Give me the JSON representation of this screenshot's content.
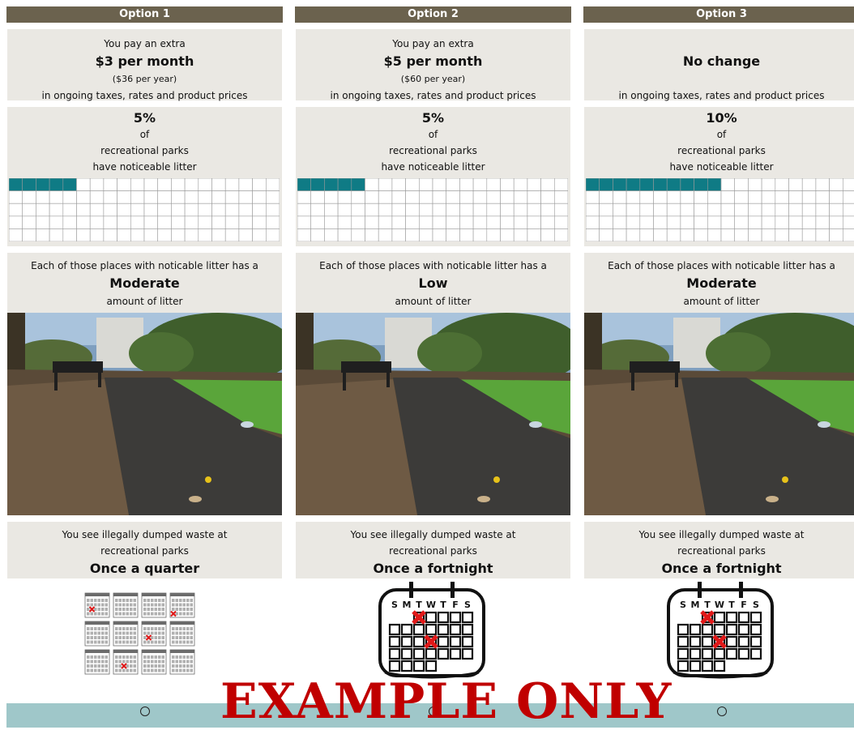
{
  "options": [
    {
      "header": "Option 1",
      "cost_line1": "You pay an extra",
      "cost_main": "$3 per month",
      "cost_sub": "($36 per year)",
      "cost_line3": "in ongoing taxes, rates and product prices",
      "pct": "5%",
      "pct_of": "of",
      "pct_place": "recreational parks",
      "pct_desc": "have noticeable litter",
      "pct_value": 5,
      "litter_intro": "Each of those places with noticable litter has a",
      "litter_level": "Moderate",
      "litter_outro": "amount of litter",
      "dump_line1": "You see illegally dumped waste at",
      "dump_line2": "recreational parks",
      "dump_freq": "Once a quarter",
      "calendar_icon": "twelve-month-calendars-icon",
      "radio_selected": false
    },
    {
      "header": "Option 2",
      "cost_line1": "You pay an extra",
      "cost_main": "$5 per month",
      "cost_sub": "($60 per year)",
      "cost_line3": "in ongoing taxes, rates and product prices",
      "pct": "5%",
      "pct_of": "of",
      "pct_place": "recreational parks",
      "pct_desc": "have noticeable litter",
      "pct_value": 5,
      "litter_intro": "Each of those places with noticable litter has a",
      "litter_level": "Low",
      "litter_outro": "amount of litter",
      "dump_line1": "You see illegally dumped waste at",
      "dump_line2": "recreational parks",
      "dump_freq": "Once a fortnight",
      "calendar_icon": "monthly-calendar-icon",
      "calendar_days": "S M T W T F S",
      "radio_selected": false
    },
    {
      "header": "Option 3",
      "cost_line1": "",
      "cost_main": "No change",
      "cost_sub": "",
      "cost_line3": "in ongoing taxes, rates and product prices",
      "pct": "10%",
      "pct_of": "of",
      "pct_place": "recreational parks",
      "pct_desc": "have noticeable litter",
      "pct_value": 10,
      "litter_intro": "Each of those places with noticable litter has a",
      "litter_level": "Moderate",
      "litter_outro": "amount of litter",
      "dump_line1": "You see illegally dumped waste at",
      "dump_line2": "recreational parks",
      "dump_freq": "Once a fortnight",
      "calendar_icon": "monthly-calendar-icon",
      "calendar_days": "S M T W T F S",
      "radio_selected": false
    }
  ],
  "watermark": "EXAMPLE ONLY",
  "colors": {
    "header_bg": "#6b624e",
    "panel_bg": "#eae8e3",
    "grid_fill": "#0f7b85",
    "mark_red": "#e01818",
    "bottom_bar": "#9fc7c9",
    "watermark": "#c00000"
  }
}
